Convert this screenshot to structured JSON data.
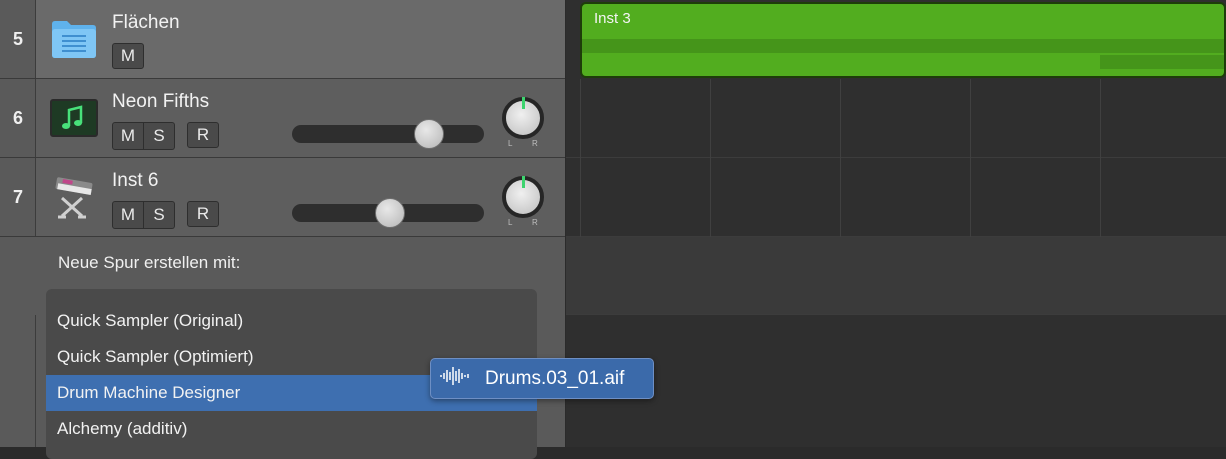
{
  "tracks": [
    {
      "number": "5",
      "name": "Flächen",
      "buttons": [
        "M"
      ],
      "icon": "folder-icon"
    },
    {
      "number": "6",
      "name": "Neon Fifths",
      "buttons": [
        "M",
        "S",
        "R"
      ],
      "icon": "music-note-icon",
      "volume": 0.71
    },
    {
      "number": "7",
      "name": "Inst 6",
      "buttons": [
        "M",
        "S",
        "R"
      ],
      "icon": "keyboard-instrument-icon",
      "volume": 0.51
    }
  ],
  "pan": {
    "left_label": "L",
    "right_label": "R"
  },
  "region": {
    "title": "Inst 3",
    "color": "#52ad1f"
  },
  "new_track": {
    "title": "Neue Spur erstellen mit:",
    "options": [
      "Quick Sampler (Original)",
      "Quick Sampler (Optimiert)",
      "Drum Machine Designer",
      "Alchemy (additiv)"
    ],
    "highlighted_index": 2
  },
  "drag": {
    "file_name": "Drums.03_01.aif",
    "icon": "audio-waveform-icon"
  },
  "colors": {
    "accent": "#3e6fb0",
    "pan_indicator": "#3cd46e"
  }
}
